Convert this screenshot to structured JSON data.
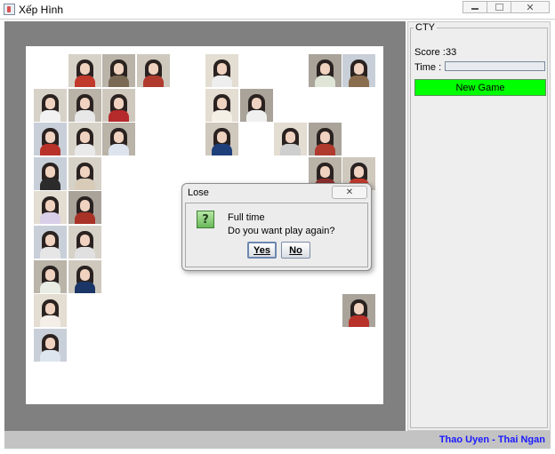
{
  "window": {
    "title": "Xếp Hình",
    "minimize_icon": "minimize-icon",
    "maximize_icon": "maximize-icon",
    "close_icon": "close-icon"
  },
  "board": {
    "tiles": [
      {
        "row": 0,
        "col": 1,
        "shirt": "#c0392b"
      },
      {
        "row": 0,
        "col": 2,
        "shirt": "#7a6a55"
      },
      {
        "row": 0,
        "col": 3,
        "shirt": "#b03a2e"
      },
      {
        "row": 0,
        "col": 5,
        "shirt": "#eeeeee"
      },
      {
        "row": 0,
        "col": 8,
        "shirt": "#dfe6d8"
      },
      {
        "row": 0,
        "col": 9,
        "shirt": "#8a6d4e"
      },
      {
        "row": 1,
        "col": 0,
        "shirt": "#f2f2f2"
      },
      {
        "row": 1,
        "col": 1,
        "shirt": "#e8e8e8"
      },
      {
        "row": 1,
        "col": 2,
        "shirt": "#b52a2a"
      },
      {
        "row": 1,
        "col": 5,
        "shirt": "#f5f0e6"
      },
      {
        "row": 1,
        "col": 6,
        "shirt": "#f0f0f0"
      },
      {
        "row": 2,
        "col": 0,
        "shirt": "#b8322a"
      },
      {
        "row": 2,
        "col": 1,
        "shirt": "#e9e9e9"
      },
      {
        "row": 2,
        "col": 2,
        "shirt": "#dde4ee"
      },
      {
        "row": 2,
        "col": 5,
        "shirt": "#1f3f7a"
      },
      {
        "row": 2,
        "col": 7,
        "shirt": "#cfcfcf"
      },
      {
        "row": 2,
        "col": 8,
        "shirt": "#b03a2e"
      },
      {
        "row": 3,
        "col": 0,
        "shirt": "#2b2b2b"
      },
      {
        "row": 3,
        "col": 1,
        "shirt": "#d8cbb8"
      },
      {
        "row": 3,
        "col": 8,
        "shirt": "#8a2d2d"
      },
      {
        "row": 3,
        "col": 9,
        "shirt": "#c0392b"
      },
      {
        "row": 4,
        "col": 0,
        "shirt": "#d9cfe8"
      },
      {
        "row": 4,
        "col": 1,
        "shirt": "#a93226"
      },
      {
        "row": 5,
        "col": 0,
        "shirt": "#e6e6e6"
      },
      {
        "row": 5,
        "col": 1,
        "shirt": "#e0e0e0"
      },
      {
        "row": 6,
        "col": 0,
        "shirt": "#e9ede4"
      },
      {
        "row": 6,
        "col": 1,
        "shirt": "#1b3566"
      },
      {
        "row": 7,
        "col": 0,
        "shirt": "#f4eee8"
      },
      {
        "row": 7,
        "col": 9,
        "shirt": "#b8322a"
      },
      {
        "row": 8,
        "col": 0,
        "shirt": "#dde5ee"
      }
    ]
  },
  "panel": {
    "group_title": "CTY",
    "score_label": "Score :",
    "score_value": "33",
    "time_label": "Time :",
    "time_progress": 0,
    "new_game_label": "New Game",
    "new_game_color": "#00ff00"
  },
  "status": {
    "credit": "Thao Uyen - Thai Ngan"
  },
  "dialog": {
    "title": "Lose",
    "icon": "question-icon",
    "line1": "Full time",
    "line2": "Do you want play again?",
    "yes_label": "Yes",
    "no_label": "No"
  }
}
